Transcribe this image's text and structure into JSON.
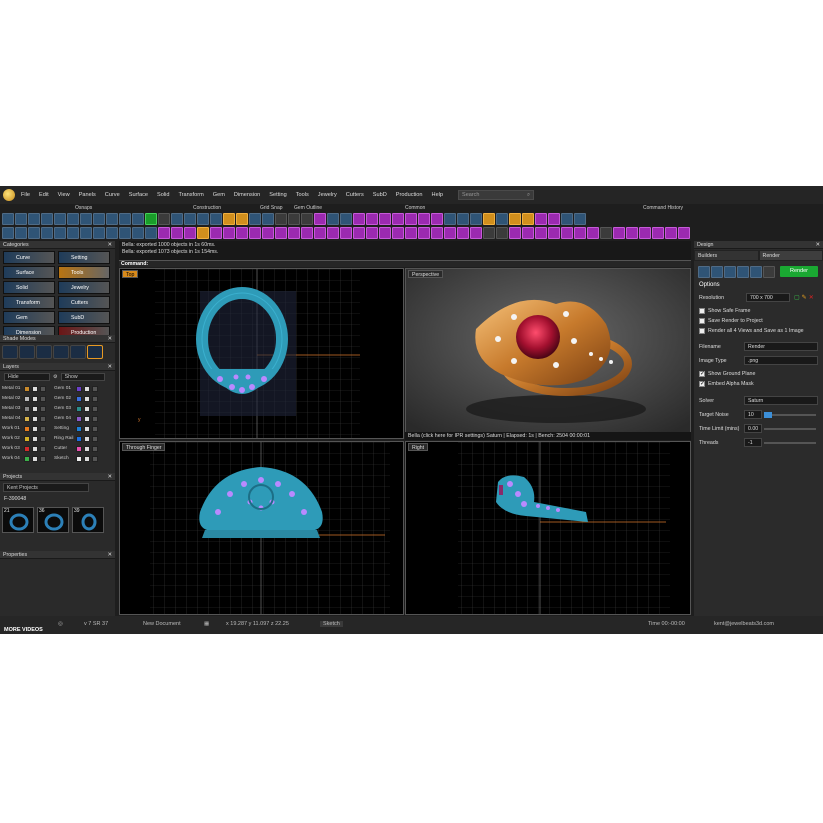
{
  "menu": [
    "File",
    "Edit",
    "View",
    "Panels",
    "Curve",
    "Surface",
    "Solid",
    "Transform",
    "Gem",
    "Dimension",
    "Setting",
    "Tools",
    "Jewelry",
    "Cutters",
    "SubD",
    "Production",
    "Help"
  ],
  "search": {
    "placeholder": "Search"
  },
  "toolbar_groups": [
    "Osnaps",
    "Construction",
    "Grid Snap",
    "Gem Outline",
    "Common"
  ],
  "command_history_label": "Command History",
  "left": {
    "categories_title": "Categories",
    "categories": [
      {
        "label": "Curve",
        "state": "normal"
      },
      {
        "label": "Setting",
        "state": "normal"
      },
      {
        "label": "Surface",
        "state": "normal"
      },
      {
        "label": "Tools",
        "state": "active"
      },
      {
        "label": "Solid",
        "state": "normal"
      },
      {
        "label": "Jewelry",
        "state": "normal"
      },
      {
        "label": "Transform",
        "state": "normal"
      },
      {
        "label": "Cutters",
        "state": "normal"
      },
      {
        "label": "Gem",
        "state": "normal"
      },
      {
        "label": "SubD",
        "state": "normal"
      },
      {
        "label": "Dimension",
        "state": "normal"
      },
      {
        "label": "Production",
        "state": "red"
      }
    ],
    "shade_modes_title": "Shade Modes",
    "layers_title": "Layers",
    "layers_hide": "Hide",
    "layers_show": "Show",
    "layers": [
      {
        "a": "Metal 01",
        "ac": "#c98a2b",
        "b": "Gem 01",
        "bc": "#6a3fc8"
      },
      {
        "a": "Metal 02",
        "ac": "#bdbdbd",
        "b": "Gem 02",
        "bc": "#3b6ee0"
      },
      {
        "a": "Metal 03",
        "ac": "#888",
        "b": "Gem 03",
        "bc": "#2a8d8d"
      },
      {
        "a": "Metal 04",
        "ac": "#d6b24a",
        "b": "Gem 04",
        "bc": "#8a5ac8"
      },
      {
        "a": "Work 01",
        "ac": "#e67c1e",
        "b": "Setting",
        "bc": "#1c7fd6"
      },
      {
        "a": "Work 02",
        "ac": "#d4b026",
        "b": "Ring Rail",
        "bc": "#1d6ee0"
      },
      {
        "a": "Work 03",
        "ac": "#d22b2b",
        "b": "Cutter",
        "bc": "#e84fb0"
      },
      {
        "a": "Work 04",
        "ac": "#3cb04a",
        "b": "Sketch",
        "bc": "#eee"
      }
    ],
    "projects_title": "Projects",
    "project_name": "Kent Projects",
    "project_file": "F-390048",
    "thumb_labels": [
      "21",
      "36",
      "39"
    ],
    "properties_title": "Properties"
  },
  "command": {
    "line1": "Bella: exported 1000 objects in 1s 60ms.",
    "line2": "Bella: exported 1073 objects in 1s 154ms.",
    "prompt": "Command:"
  },
  "viewports": {
    "top": "Top",
    "perspective": "Perspective",
    "through_finger": "Through Finger",
    "right": "Right"
  },
  "ipr_status": "Bella (click here for IPR settings)  Saturn | Elapsed: 1s | Bench: 2504   00:00:01",
  "right": {
    "title": "Design",
    "tab_builders": "Builders",
    "tab_render": "Render",
    "render_button": "Render",
    "options_title": "Options",
    "resolution_label": "Resolution",
    "resolution_value": "700 x 700",
    "show_safe_frame": "Show Safe Frame",
    "save_to_project": "Save Render to Project",
    "render_all": "Render all 4 Views and Save as 1 Image",
    "filename_label": "Filename",
    "filename_value": "Render",
    "image_type_label": "Image Type",
    "image_type_value": ".png",
    "show_ground": "Show Ground Plane",
    "embed_alpha": "Embed Alpha Mask",
    "solver_label": "Solver",
    "solver_value": "Saturn",
    "target_noise_label": "Target Noise",
    "target_noise_value": "10",
    "time_limit_label": "Time Limit (mins)",
    "time_limit_value": "0.00",
    "threads_label": "Threads",
    "threads_value": "-1"
  },
  "status": {
    "version": "v 7 SR 37",
    "doc": "New Document",
    "coords": "x 19.287 y 11.097 z 22.25",
    "sketch": "Sketch",
    "time": "Time 00:-00:00",
    "email": "kent@jewelbeats3d.com",
    "more_videos": "MORE VIDEOS"
  }
}
